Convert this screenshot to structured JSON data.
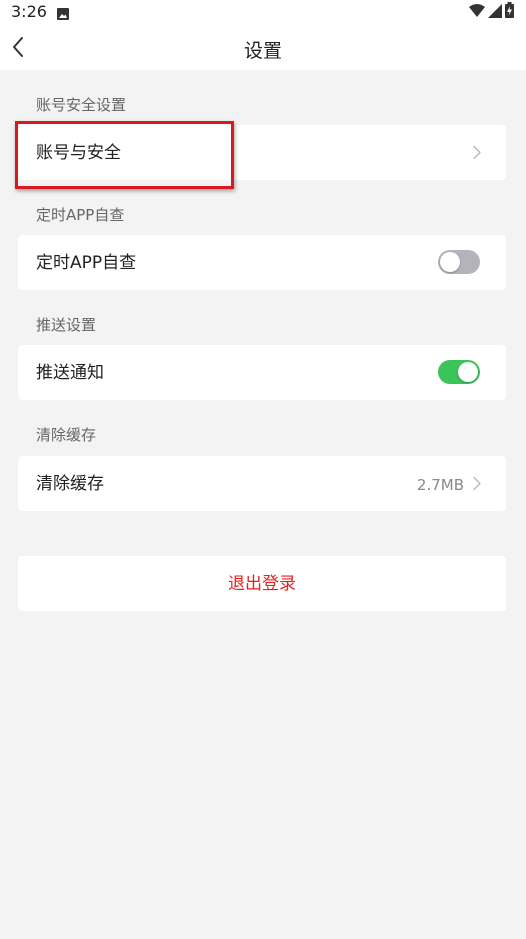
{
  "status_bar": {
    "time": "3:26",
    "icons": [
      "image-icon",
      "wifi-icon",
      "signal-icon",
      "battery-icon"
    ]
  },
  "header": {
    "title": "设置",
    "back_icon": "chevron-left-icon"
  },
  "sections": [
    {
      "label": "账号安全设置",
      "item": {
        "label": "账号与安全",
        "control": "chevron",
        "highlighted": true
      }
    },
    {
      "label": "定时APP自查",
      "item": {
        "label": "定时APP自查",
        "control": "toggle",
        "enabled": false
      }
    },
    {
      "label": "推送设置",
      "item": {
        "label": "推送通知",
        "control": "toggle",
        "enabled": true
      }
    },
    {
      "label": "清除缓存",
      "item": {
        "label": "清除缓存",
        "control": "chevron",
        "value": "2.7MB"
      }
    }
  ],
  "logout": {
    "label": "退出登录"
  },
  "colors": {
    "background": "#f3f3f3",
    "card": "#ffffff",
    "toggle_on": "#3cc45a",
    "toggle_off": "#b4b3bb",
    "logout_text": "#e22420",
    "highlight": "#d9191b"
  }
}
